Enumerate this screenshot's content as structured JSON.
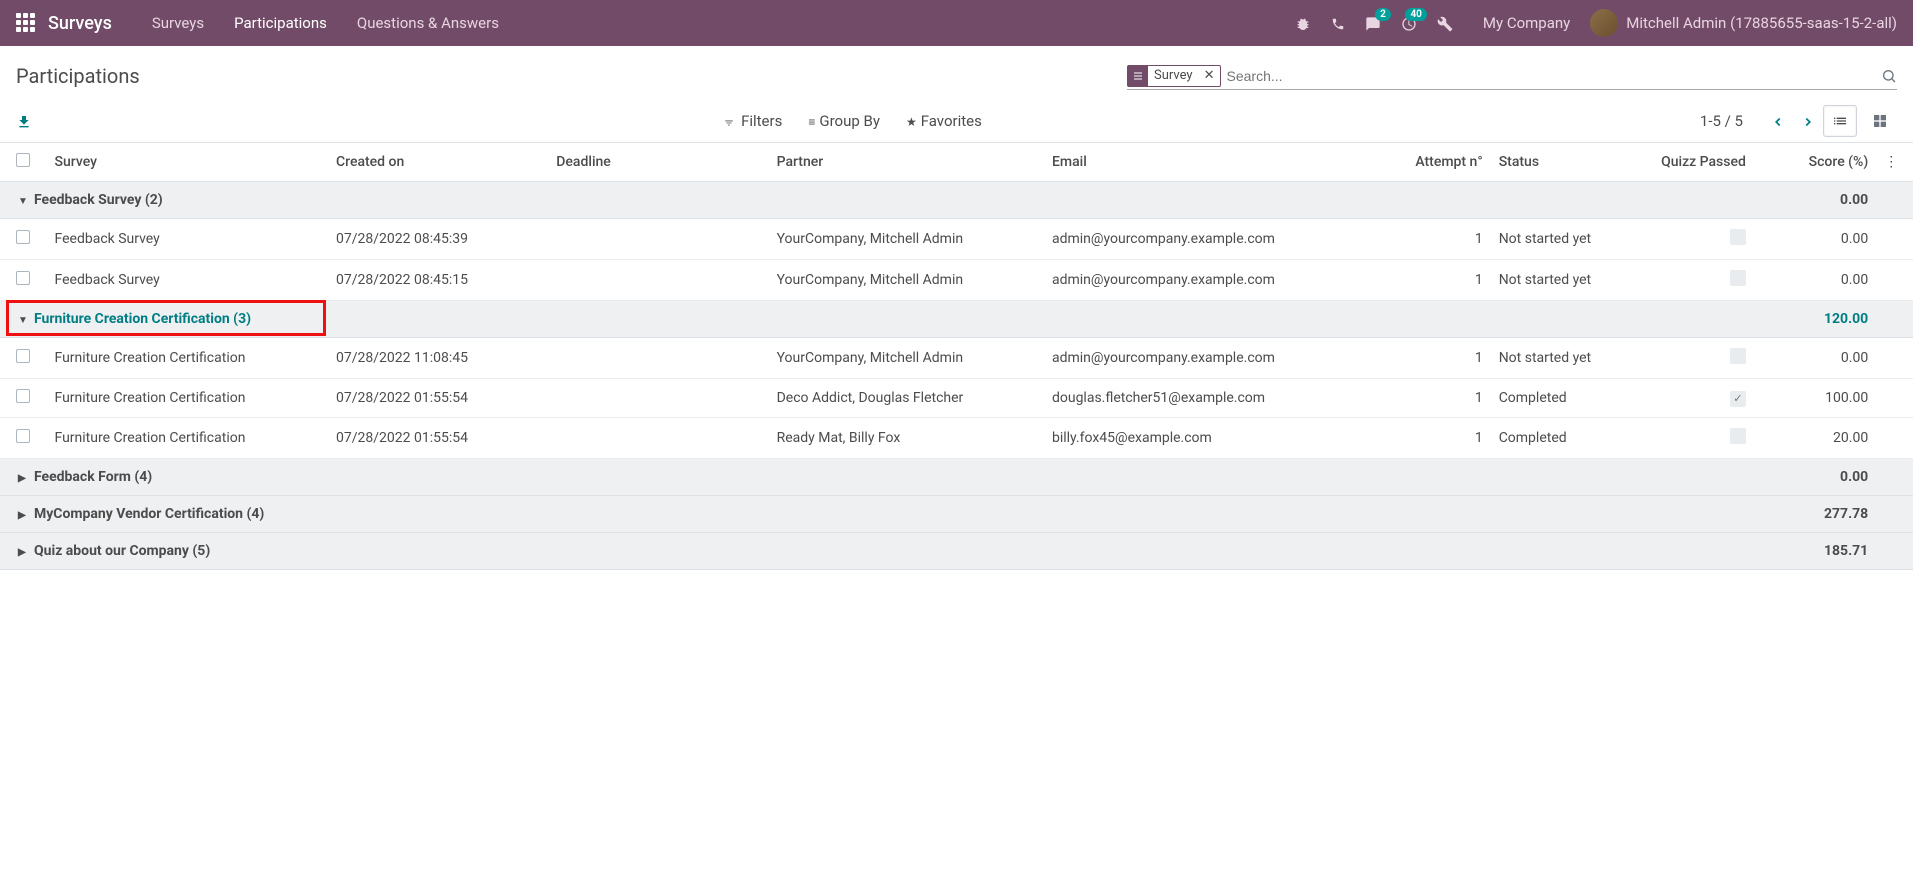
{
  "navbar": {
    "brand": "Surveys",
    "links": [
      "Surveys",
      "Participations",
      "Questions & Answers"
    ],
    "msg_badge": "2",
    "activity_badge": "40",
    "company": "My Company",
    "username": "Mitchell Admin (17885655-saas-15-2-all)"
  },
  "control": {
    "title": "Participations",
    "facet_label": "Survey",
    "search_placeholder": "Search...",
    "filters_label": "Filters",
    "groupby_label": "Group By",
    "favorites_label": "Favorites",
    "pager": "1-5 / 5"
  },
  "columns": {
    "survey": "Survey",
    "created": "Created on",
    "deadline": "Deadline",
    "partner": "Partner",
    "email": "Email",
    "attempt": "Attempt n°",
    "status": "Status",
    "quiz": "Quizz Passed",
    "score": "Score (%)"
  },
  "groups": [
    {
      "label": "Feedback Survey (2)",
      "expanded": true,
      "highlighted": false,
      "score": "0.00",
      "rows": [
        {
          "survey": "Feedback Survey",
          "created": "07/28/2022 08:45:39",
          "deadline": "",
          "partner": "YourCompany, Mitchell Admin",
          "email": "admin@yourcompany.example.com",
          "attempt": "1",
          "status": "Not started yet",
          "quiz": false,
          "score": "0.00"
        },
        {
          "survey": "Feedback Survey",
          "created": "07/28/2022 08:45:15",
          "deadline": "",
          "partner": "YourCompany, Mitchell Admin",
          "email": "admin@yourcompany.example.com",
          "attempt": "1",
          "status": "Not started yet",
          "quiz": false,
          "score": "0.00"
        }
      ]
    },
    {
      "label": "Furniture Creation Certification (3)",
      "expanded": true,
      "highlighted": true,
      "score": "120.00",
      "rows": [
        {
          "survey": "Furniture Creation Certification",
          "created": "07/28/2022 11:08:45",
          "deadline": "",
          "partner": "YourCompany, Mitchell Admin",
          "email": "admin@yourcompany.example.com",
          "attempt": "1",
          "status": "Not started yet",
          "quiz": false,
          "score": "0.00"
        },
        {
          "survey": "Furniture Creation Certification",
          "created": "07/28/2022 01:55:54",
          "deadline": "",
          "partner": "Deco Addict, Douglas Fletcher",
          "email": "douglas.fletcher51@example.com",
          "attempt": "1",
          "status": "Completed",
          "quiz": true,
          "score": "100.00"
        },
        {
          "survey": "Furniture Creation Certification",
          "created": "07/28/2022 01:55:54",
          "deadline": "",
          "partner": "Ready Mat, Billy Fox",
          "email": "billy.fox45@example.com",
          "attempt": "1",
          "status": "Completed",
          "quiz": false,
          "score": "20.00"
        }
      ]
    },
    {
      "label": "Feedback Form (4)",
      "expanded": false,
      "highlighted": false,
      "score": "0.00",
      "rows": []
    },
    {
      "label": "MyCompany Vendor Certification (4)",
      "expanded": false,
      "highlighted": false,
      "score": "277.78",
      "rows": []
    },
    {
      "label": "Quiz about our Company (5)",
      "expanded": false,
      "highlighted": false,
      "score": "185.71",
      "rows": []
    }
  ]
}
